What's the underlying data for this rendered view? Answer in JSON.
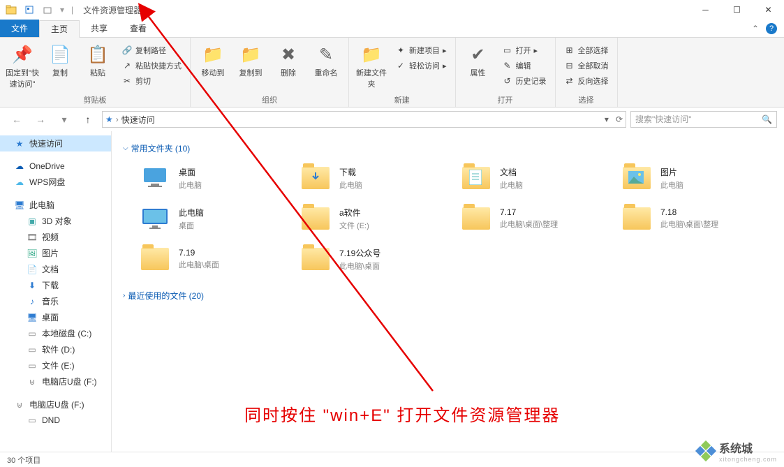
{
  "title": "文件资源管理器",
  "tabs": {
    "file": "文件",
    "home": "主页",
    "share": "共享",
    "view": "查看"
  },
  "ribbon": {
    "clipboard": {
      "label": "剪贴板",
      "pin": "固定到\"快速访问\"",
      "copy": "复制",
      "paste": "粘贴",
      "copypath": "复制路径",
      "pasteshortcut": "粘贴快捷方式",
      "cut": "剪切"
    },
    "organize": {
      "label": "组织",
      "moveto": "移动到",
      "copyto": "复制到",
      "delete": "删除",
      "rename": "重命名"
    },
    "new": {
      "label": "新建",
      "newfolder": "新建文件夹",
      "newitem": "新建项目",
      "easyaccess": "轻松访问"
    },
    "open": {
      "label": "打开",
      "properties": "属性",
      "open": "打开",
      "edit": "编辑",
      "history": "历史记录"
    },
    "select": {
      "label": "选择",
      "selectall": "全部选择",
      "selectnone": "全部取消",
      "invert": "反向选择"
    }
  },
  "breadcrumb": "快速访问",
  "search_placeholder": "搜索\"快速访问\"",
  "sidebar": [
    {
      "name": "快速访问",
      "icon": "star",
      "sel": true,
      "lvl": 1
    },
    {
      "name": "OneDrive",
      "icon": "cloud-blue",
      "lvl": 1
    },
    {
      "name": "WPS网盘",
      "icon": "cloud-lt",
      "lvl": 1
    },
    {
      "name": "此电脑",
      "icon": "pc",
      "lvl": 1
    },
    {
      "name": "3D 对象",
      "icon": "3d",
      "lvl": 2
    },
    {
      "name": "视频",
      "icon": "video",
      "lvl": 2
    },
    {
      "name": "图片",
      "icon": "pic",
      "lvl": 2
    },
    {
      "name": "文档",
      "icon": "doc",
      "lvl": 2
    },
    {
      "name": "下载",
      "icon": "dl",
      "lvl": 2
    },
    {
      "name": "音乐",
      "icon": "music",
      "lvl": 2
    },
    {
      "name": "桌面",
      "icon": "desk",
      "lvl": 2
    },
    {
      "name": "本地磁盘 (C:)",
      "icon": "disk",
      "lvl": 2
    },
    {
      "name": "软件 (D:)",
      "icon": "disk",
      "lvl": 2
    },
    {
      "name": "文件 (E:)",
      "icon": "disk",
      "lvl": 2
    },
    {
      "name": "电脑店U盘 (F:)",
      "icon": "usb",
      "lvl": 2
    },
    {
      "name": "电脑店U盘 (F:)",
      "icon": "usb",
      "lvl": 1
    },
    {
      "name": "DND",
      "icon": "disk",
      "lvl": 2
    }
  ],
  "section1": "常用文件夹 (10)",
  "folders": [
    {
      "name": "桌面",
      "sub": "此电脑",
      "t": "desk"
    },
    {
      "name": "下载",
      "sub": "此电脑",
      "t": "dl"
    },
    {
      "name": "文档",
      "sub": "此电脑",
      "t": "doc"
    },
    {
      "name": "图片",
      "sub": "此电脑",
      "t": "pic"
    },
    {
      "name": "此电脑",
      "sub": "桌面",
      "t": "pc"
    },
    {
      "name": "a软件",
      "sub": "文件 (E:)",
      "t": "f"
    },
    {
      "name": "7.17",
      "sub": "此电脑\\桌面\\整理",
      "t": "f"
    },
    {
      "name": "7.18",
      "sub": "此电脑\\桌面\\整理",
      "t": "f"
    },
    {
      "name": "7.19",
      "sub": "此电脑\\桌面",
      "t": "f"
    },
    {
      "name": "7.19公众号",
      "sub": "此电脑\\桌面",
      "t": "f"
    }
  ],
  "section2": "最近使用的文件 (20)",
  "status": "30 个项目",
  "annotation": "同时按住 \"win+E\" 打开文件资源管理器",
  "wm": {
    "t1": "系统城",
    "t2": "xitongcheng.com"
  }
}
